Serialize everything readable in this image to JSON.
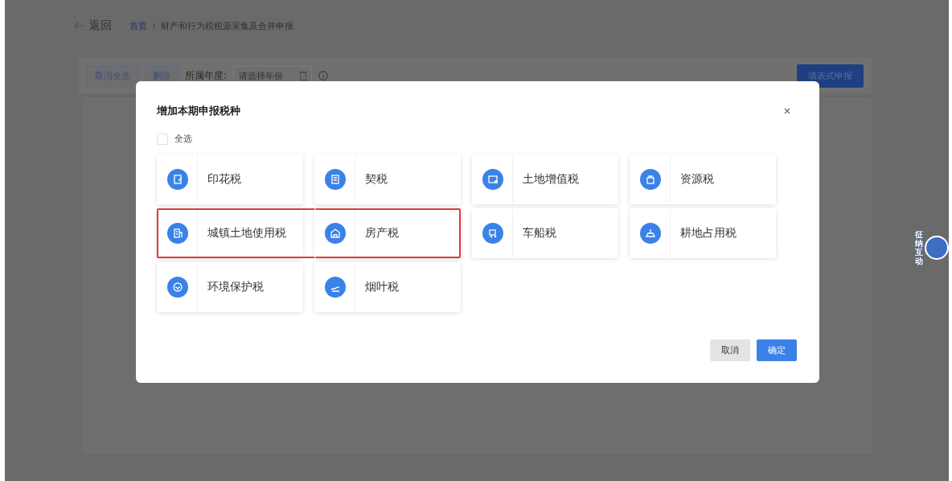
{
  "page": {
    "back": "返回",
    "breadcrumb": [
      {
        "label": "首页",
        "kind": "link"
      },
      {
        "label": "财产和行为税税源采集及合并申报",
        "kind": "current"
      }
    ],
    "toolbar": {
      "buttons": [
        "取消全选",
        "删除"
      ],
      "year_label": "所属年度:",
      "year_placeholder": "请选择年份",
      "submit": "填表式申报"
    }
  },
  "dialog": {
    "title": "增加本期申报税种",
    "select_all": {
      "label": "全选",
      "checked": false
    },
    "taxes": [
      {
        "label": "印花税",
        "highlighted": false
      },
      {
        "label": "契税",
        "highlighted": false
      },
      {
        "label": "土地增值税",
        "highlighted": false
      },
      {
        "label": "资源税",
        "highlighted": false
      },
      {
        "label": "城镇土地使用税",
        "highlighted": true
      },
      {
        "label": "房产税",
        "highlighted": true
      },
      {
        "label": "车船税",
        "highlighted": false
      },
      {
        "label": "耕地占用税",
        "highlighted": false
      },
      {
        "label": "环境保护税",
        "highlighted": false
      },
      {
        "label": "烟叶税",
        "highlighted": false
      }
    ],
    "buttons": [
      {
        "label": "取消",
        "kind": "secondary"
      },
      {
        "label": "确定",
        "kind": "primary"
      }
    ]
  },
  "mascot": {
    "chars": [
      "征",
      "纳",
      "互",
      "动"
    ]
  }
}
